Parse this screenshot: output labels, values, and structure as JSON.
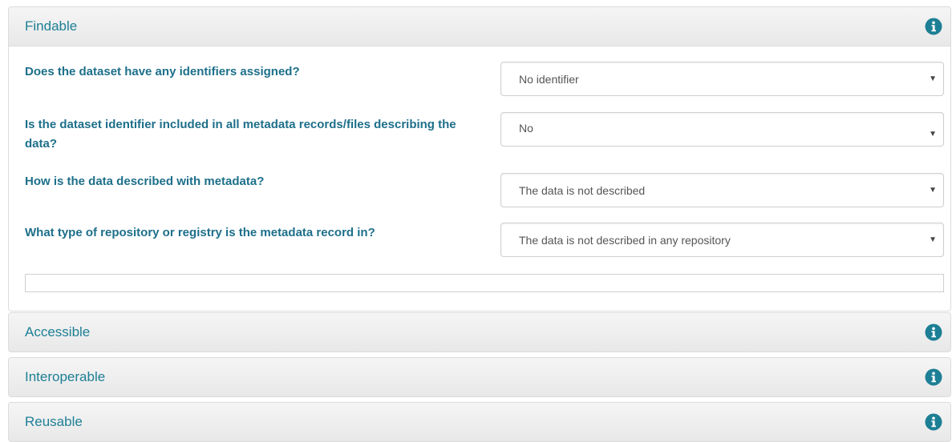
{
  "panels": {
    "findable": {
      "title": "Findable",
      "icon": "info-icon"
    },
    "accessible": {
      "title": "Accessible",
      "icon": "info-icon"
    },
    "interoperable": {
      "title": "Interoperable",
      "icon": "info-icon"
    },
    "reusable": {
      "title": "Reusable",
      "icon": "info-icon"
    }
  },
  "questions": [
    {
      "label": "Does the dataset have any identifiers assigned?",
      "selected": "No identifier"
    },
    {
      "label": "Is the dataset identifier included in all metadata records/files describing the data?",
      "selected": "No"
    },
    {
      "label": "How is the data described with metadata?",
      "selected": "The data is not described"
    },
    {
      "label": "What type of repository or registry is the metadata record in?",
      "selected": "The data is not described in any repository"
    }
  ],
  "notes_value": "",
  "colors": {
    "title": "#1d7f95",
    "question": "#1d6f8a",
    "info_icon": "#1d7f95",
    "header_bg": "#efefef",
    "border": "#dcdcdc"
  }
}
